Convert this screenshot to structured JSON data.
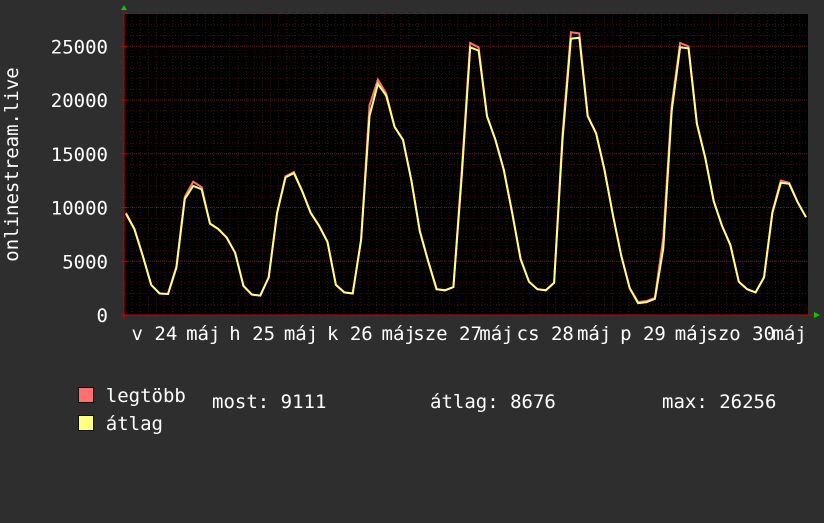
{
  "chart_data": {
    "type": "area",
    "ylabel": "onlinestream.live",
    "ylim": [
      0,
      28000
    ],
    "yticks": [
      0,
      5000,
      10000,
      15000,
      20000,
      25000
    ],
    "grid": true,
    "x_labels": [
      "v 24",
      "máj",
      "h 25",
      "máj",
      "k 26",
      "máj",
      "sze 27",
      "máj",
      "cs 28",
      "máj",
      "p 29",
      "máj",
      "szo 30",
      "máj"
    ],
    "colors": {
      "background": "#2e2e2e",
      "plot": "#000000",
      "grid": "#3d1010",
      "axis": "#cc0000",
      "text": "#ffffff",
      "max_series": "#ff7070",
      "avg_series": "#ffff80"
    },
    "series": [
      {
        "name": "legtöbb",
        "values": [
          9500,
          8000,
          5500,
          2800,
          2000,
          1950,
          4500,
          11000,
          12400,
          11900,
          8500,
          8000,
          7200,
          5800,
          2700,
          1900,
          1800,
          3500,
          9500,
          12900,
          13300,
          11500,
          9500,
          8300,
          6800,
          2800,
          2100,
          2000,
          7000,
          19500,
          21900,
          20600,
          17500,
          16300,
          12500,
          7800,
          5000,
          2400,
          2300,
          2600,
          13500,
          25300,
          24900,
          18500,
          16300,
          13500,
          9500,
          5200,
          3100,
          2400,
          2300,
          3000,
          16800,
          26300,
          26200,
          18500,
          16900,
          13500,
          9300,
          5500,
          2500,
          1200,
          1300,
          1600,
          7200,
          19500,
          25300,
          25000,
          17800,
          14600,
          10600,
          8300,
          6500,
          3100,
          2400,
          2100,
          3500,
          9600,
          12500,
          12300,
          10500,
          9100
        ]
      },
      {
        "name": "átlag",
        "values": [
          9400,
          8000,
          5500,
          2800,
          2000,
          1950,
          4400,
          10800,
          12000,
          11700,
          8500,
          8000,
          7200,
          5800,
          2700,
          1900,
          1800,
          3500,
          9500,
          12800,
          13200,
          11500,
          9500,
          8300,
          6800,
          2800,
          2100,
          2000,
          7000,
          18500,
          21500,
          20400,
          17500,
          16300,
          12500,
          7800,
          5000,
          2400,
          2300,
          2600,
          13000,
          24900,
          24600,
          18500,
          16300,
          13500,
          9500,
          5200,
          3100,
          2400,
          2300,
          3000,
          16300,
          25700,
          25800,
          18500,
          16900,
          13500,
          9300,
          5500,
          2500,
          1100,
          1200,
          1500,
          6200,
          19000,
          24900,
          24800,
          17800,
          14600,
          10600,
          8300,
          6500,
          3100,
          2400,
          2100,
          3500,
          9500,
          12300,
          12200,
          10500,
          9100
        ]
      }
    ]
  },
  "legend": {
    "max_label": "legtöbb",
    "avg_label": "átlag",
    "now": "most: 9111",
    "average": "átlag: 8676",
    "maximum": "max: 26256"
  }
}
